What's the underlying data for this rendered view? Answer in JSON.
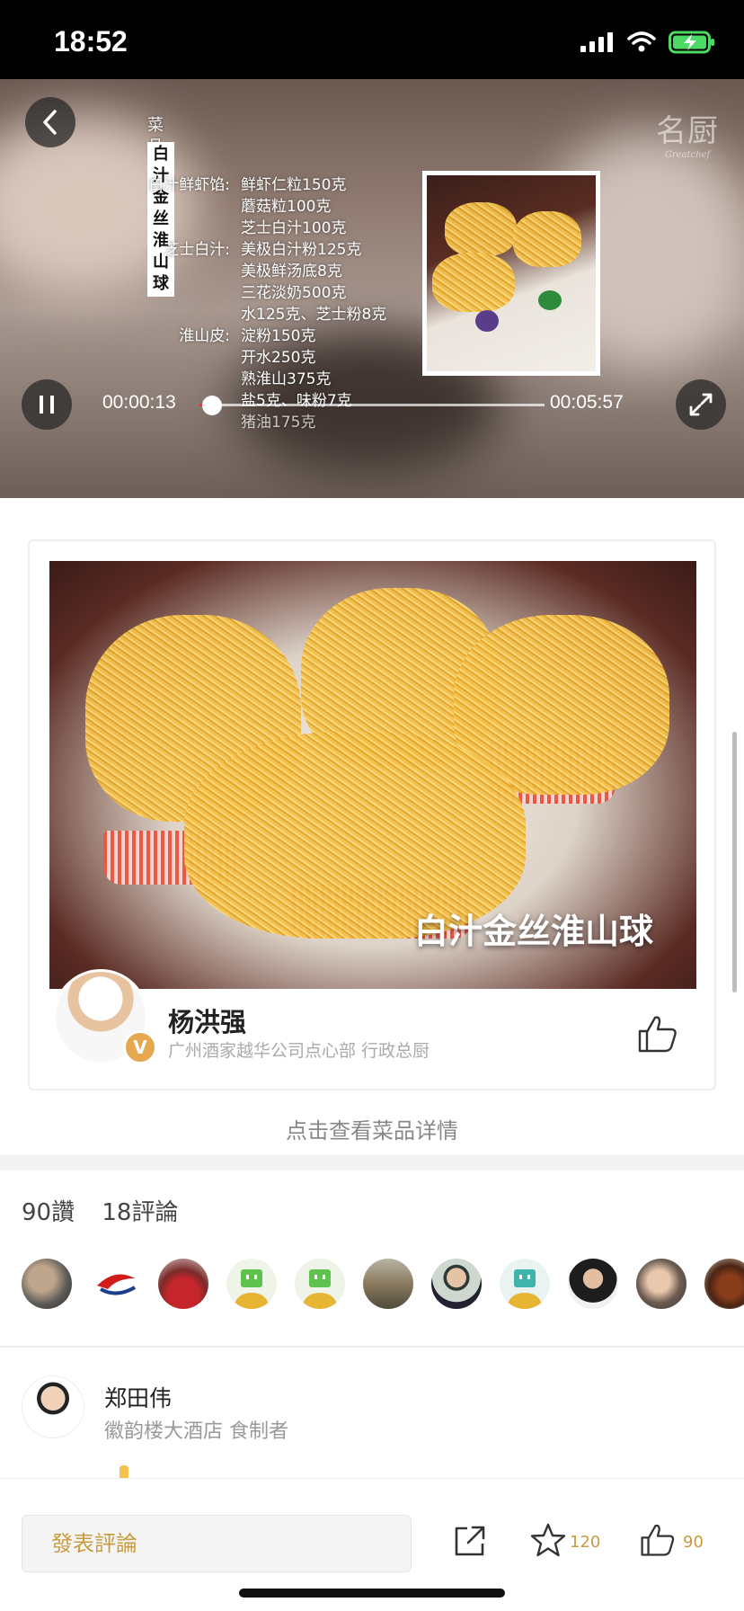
{
  "status_bar": {
    "time": "18:52"
  },
  "video": {
    "watermark_main": "名厨",
    "watermark_sub": "Greatchef",
    "intro_title": "菜品主辅料介绍:",
    "dish_tag": "白汁金丝淮山球",
    "ingredients": [
      {
        "label": "白汁鲜虾馅:",
        "items": [
          "鲜虾仁粒150克",
          "蘑菇粒100克",
          "芝士白汁100克"
        ]
      },
      {
        "label": "芝士白汁:",
        "items": [
          "美极白汁粉125克",
          "美极鲜汤底8克",
          "三花淡奶500克",
          "水125克、芝士粉8克"
        ]
      },
      {
        "label": "淮山皮:",
        "items": [
          "淀粉150克",
          "开水250克",
          "熟淮山375克",
          "盐5克、味粉7克",
          "猪油175克"
        ]
      }
    ],
    "current_time": "00:00:13",
    "total_time": "00:05:57",
    "progress": 0.036
  },
  "card": {
    "caption": "白汁金丝淮山球",
    "chef_name": "杨洪强",
    "chef_title": "广州酒家越华公司点心部 行政总厨",
    "verified_badge": "V"
  },
  "detail_link": "点击查看菜品详情",
  "stats": {
    "likes": "90讚",
    "comments": "18評論"
  },
  "liker_avatars": [
    {
      "name": "avatar-chef"
    },
    {
      "name": "avatar-airline-logo"
    },
    {
      "name": "avatar-group-photo"
    },
    {
      "name": "avatar-default"
    },
    {
      "name": "avatar-default"
    },
    {
      "name": "avatar-landscape"
    },
    {
      "name": "avatar-man"
    },
    {
      "name": "avatar-default-teal"
    },
    {
      "name": "avatar-man-dark"
    },
    {
      "name": "avatar-man-selfie"
    },
    {
      "name": "avatar-tea"
    }
  ],
  "comment": {
    "author": "郑田伟",
    "org": "徽韵楼大酒店 食制者"
  },
  "bottom_bar": {
    "comment_placeholder": "發表評論",
    "star_count": "120",
    "like_count": "90"
  },
  "colors": {
    "accent": "#c99a3e",
    "progress": "#e53935",
    "badge": "#e5a84f"
  }
}
